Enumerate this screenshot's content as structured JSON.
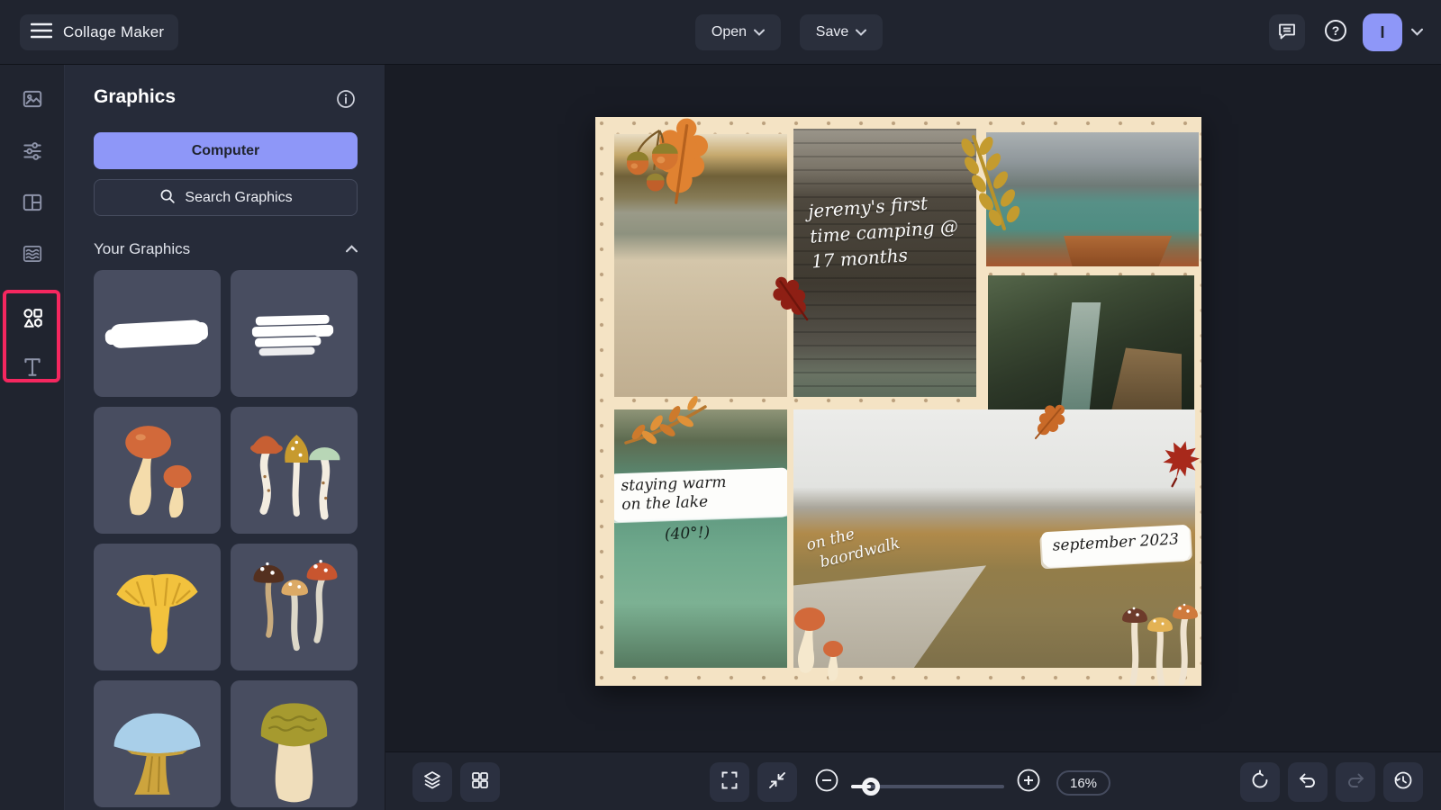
{
  "topbar": {
    "title": "Collage Maker",
    "open_label": "Open",
    "save_label": "Save",
    "avatar_initial": "I"
  },
  "rail": {
    "items": [
      "image-manager",
      "edit",
      "layouts",
      "patterns",
      "graphics",
      "text"
    ],
    "active_item": "graphics",
    "highlight_color": "#f5275f"
  },
  "panel": {
    "title": "Graphics",
    "computer_button": "Computer",
    "search_label": "Search Graphics",
    "section_title": "Your Graphics",
    "tiles": [
      "white-brush-stroke",
      "white-brush-stroke-textured",
      "orange-mushroom-pair",
      "skinny-mushroom-trio",
      "yellow-chanterelle",
      "spotted-mushroom-cluster",
      "blue-cap-mushroom",
      "porcini-mushroom"
    ]
  },
  "canvas": {
    "collage": {
      "background_color": "#f4e3c4",
      "photos": [
        "lakeshore-piggyback",
        "log-cabin",
        "boat-on-alpine-lake",
        "gorge-boardwalk",
        "holding-baby-by-lake",
        "autumn-boardwalk-walk"
      ],
      "stickers": [
        "acorn-cluster",
        "orange-oak-leaf",
        "dark-red-oak-leaf",
        "gold-leaf-branch",
        "orange-rowan-branch",
        "small-orange-oak-leaf",
        "red-maple-leaf",
        "mushroom-pair",
        "tall-mushroom-trio"
      ],
      "captions": {
        "cabin": [
          "jeremy's first",
          "time camping @",
          "17 months"
        ],
        "lake": [
          "staying warm",
          "on the lake"
        ],
        "lake_temp": "(40°!)",
        "boardwalk": [
          "on the",
          "baordwalk"
        ],
        "date": "september 2023"
      }
    }
  },
  "toolbar": {
    "zoom_value": "16%"
  },
  "colors": {
    "accent": "#8e97f8",
    "highlight_pink": "#f5275f",
    "topbar_bg": "#20242f",
    "panel_bg": "#262b39",
    "canvas_bg": "#191c25",
    "tile_bg": "#484d60",
    "collage_cream": "#f4e3c4"
  }
}
